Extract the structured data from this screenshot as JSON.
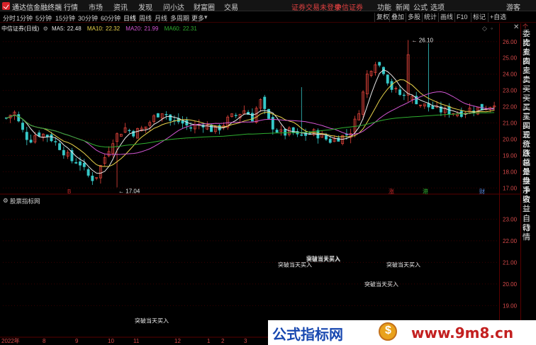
{
  "app": {
    "title": "通达信金融终端",
    "menu": [
      "行情",
      "市场",
      "资讯",
      "发现",
      "问小达",
      "财富圈",
      "交易"
    ],
    "notice": "证券交易未登录",
    "broker": "中信证券",
    "right_menu": [
      "功能",
      "新闻",
      "公式",
      "选项"
    ],
    "user": "游客"
  },
  "toolbar": {
    "periods": [
      "分时",
      "1分钟",
      "5分钟",
      "15分钟",
      "30分钟",
      "60分钟",
      "日线",
      "周线",
      "月线",
      "多周期",
      "更多"
    ],
    "active": "日线",
    "buttons": [
      "复权",
      "叠加",
      "多股",
      "统计",
      "画线",
      "F10",
      "标记",
      "+自选"
    ]
  },
  "legend": {
    "name": "中信证券(日线)",
    "ma": [
      {
        "label": "MA5:",
        "value": "22.48",
        "color": "#e8e8e8"
      },
      {
        "label": "MA10:",
        "value": "22.32",
        "color": "#e8d24a"
      },
      {
        "label": "MA20:",
        "value": "21.99",
        "color": "#d356d3"
      },
      {
        "label": "MA60:",
        "value": "22.31",
        "color": "#2fae2f"
      }
    ]
  },
  "main_axis": [
    "26.00",
    "25.00",
    "24.00",
    "23.00",
    "22.00",
    "21.00",
    "20.00",
    "19.00",
    "18.00",
    "17.00"
  ],
  "main_ylim": [
    16.8,
    26.6
  ],
  "high_label": "26.10",
  "low_label": "17.04",
  "markers": [
    {
      "text": "B",
      "color": "#cc2a2a"
    },
    {
      "text": "涨",
      "color": "#cc2a2a"
    },
    {
      "text": "港",
      "color": "#2fae2f"
    },
    {
      "text": "财",
      "color": "#5a8ae0"
    }
  ],
  "sub": {
    "title": "股票指标网",
    "axis": [
      "23.00",
      "22.00",
      "21.00",
      "20.00",
      "19.00"
    ],
    "ylim": [
      17.6,
      23.8
    ]
  },
  "signals": [
    {
      "text": "突破当天买入"
    },
    {
      "text": "突破当天买入"
    },
    {
      "text": "突破当天买入"
    },
    {
      "text": "突破当天买入"
    },
    {
      "text": "突破当天买入"
    }
  ],
  "x_axis": [
    "2022年",
    "8",
    "9",
    "10",
    "11",
    "12",
    "1",
    "2",
    "3"
  ],
  "right_panel": {
    "top": "个",
    "side": [
      "委比",
      "卖五",
      "卖四",
      "卖三",
      "卖二",
      "卖一",
      "买一",
      "买二",
      "买三",
      "买四",
      "买五",
      "现价",
      "涨跌",
      "涨幅",
      "总量",
      "外盘",
      "换手",
      "净资",
      "收益"
    ],
    "bottom": [
      "自动",
      "行情"
    ]
  },
  "watermark": {
    "left": "公式指标网",
    "right": "www.9m8.cn"
  },
  "colors": {
    "up": "#e8453c",
    "down": "#36c8c8",
    "axis_red": "#5a0000"
  }
}
